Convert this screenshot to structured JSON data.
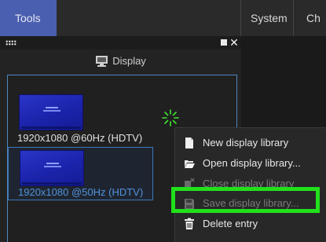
{
  "menubar": {
    "tools": "Tools",
    "system": "System",
    "ch": "Ch"
  },
  "panel": {
    "header": "Display",
    "entries": [
      {
        "label": "1920x1080 @60Hz (HDTV)",
        "selected": false
      },
      {
        "label": "1920x1080 @50Hz (HDTV)",
        "selected": true
      }
    ]
  },
  "context_menu": {
    "items": [
      {
        "label": "New display library",
        "icon": "file-icon",
        "enabled": true
      },
      {
        "label": "Open display library...",
        "icon": "folder-open-icon",
        "enabled": true
      },
      {
        "label": "Close display library",
        "icon": "close-file-icon",
        "enabled": false
      },
      {
        "label": "Save display library...",
        "icon": "floppy-disk-icon",
        "enabled": false
      },
      {
        "label": "Delete entry",
        "icon": "trash-icon",
        "enabled": true
      }
    ]
  },
  "colors": {
    "tools_tab": "#4a5fb0",
    "selection_border": "#4d86c0",
    "selected_text": "#4f93dc",
    "highlight_box": "#21e01b"
  }
}
